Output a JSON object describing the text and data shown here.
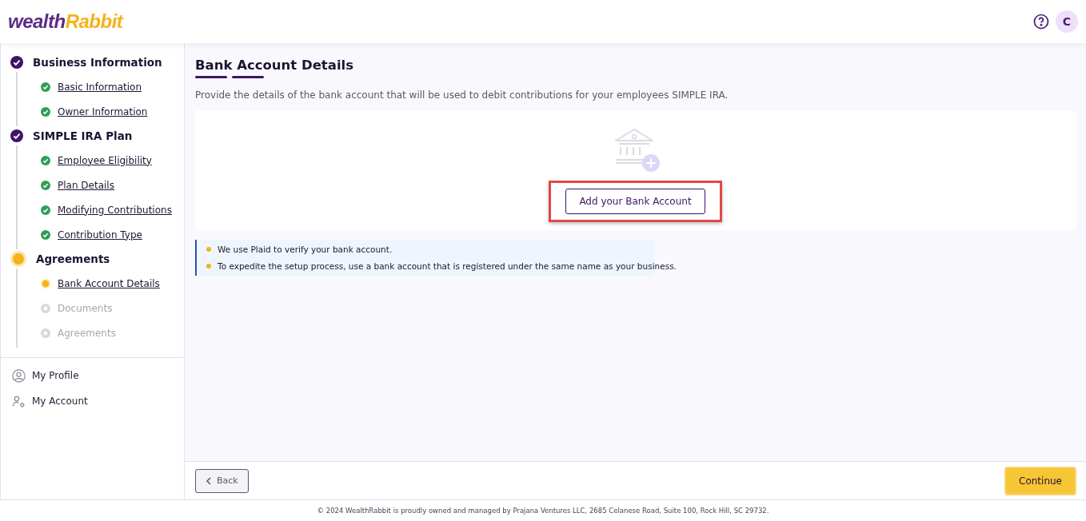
{
  "header": {
    "logo": {
      "first": "wealth",
      "second": "Rabbit"
    },
    "avatar": "C"
  },
  "steps": [
    {
      "title": "Business Information",
      "completed": true,
      "current": false,
      "children": [
        {
          "label": "Basic Information",
          "completed": true,
          "current": false
        },
        {
          "label": "Owner Information",
          "completed": true,
          "current": false
        }
      ]
    },
    {
      "title": "SIMPLE IRA Plan",
      "completed": true,
      "current": false,
      "children": [
        {
          "label": "Employee Eligibility",
          "completed": true,
          "current": false
        },
        {
          "label": "Plan Details",
          "completed": true,
          "current": false
        },
        {
          "label": "Modifying Contributions",
          "completed": true,
          "current": false
        },
        {
          "label": "Contribution Type",
          "completed": true,
          "current": false
        }
      ]
    },
    {
      "title": "Agreements",
      "completed": false,
      "current": true,
      "children": [
        {
          "label": "Bank Account Details",
          "completed": false,
          "current": true
        },
        {
          "label": "Documents",
          "completed": false,
          "current": false
        },
        {
          "label": "Agreements",
          "completed": false,
          "current": false
        }
      ]
    }
  ],
  "account_links": [
    {
      "kind": "profile",
      "label": "My Profile"
    },
    {
      "kind": "account",
      "label": "My Account"
    }
  ],
  "page": {
    "title": "Bank Account Details",
    "description": "Provide the details of the bank account that will be used to debit contributions for your employees SIMPLE IRA.",
    "add_button": "Add your Bank Account",
    "add_button_highlighted": true,
    "notes": [
      "We use Plaid to verify your bank account.",
      "To expedite the setup process, use a bank account that is registered under the same name as your business."
    ]
  },
  "actions": {
    "back": "Back",
    "continue": "Continue"
  },
  "footer": "© 2024 WealthRabbit is proudly owned and managed by Prajana Ventures LLC, 2685 Celanese Road, Suite 100, Rock Hill, SC 29732."
}
